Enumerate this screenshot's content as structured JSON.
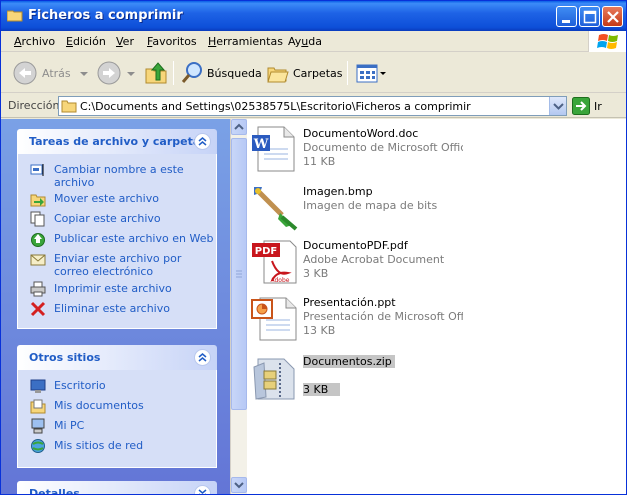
{
  "window": {
    "title": "Ficheros a comprimir"
  },
  "menu": [
    {
      "pre": "",
      "u": "A",
      "post": "rchivo"
    },
    {
      "pre": "",
      "u": "E",
      "post": "dición"
    },
    {
      "pre": "",
      "u": "V",
      "post": "er"
    },
    {
      "pre": "",
      "u": "F",
      "post": "avoritos"
    },
    {
      "pre": "",
      "u": "H",
      "post": "erramientas"
    },
    {
      "pre": "Ay",
      "u": "u",
      "post": "da"
    }
  ],
  "toolbar": {
    "back": "Atrás",
    "search": "Búsqueda",
    "folders": "Carpetas"
  },
  "address": {
    "label": "Dirección",
    "path": "C:\\Documents and Settings\\02538575L\\Escritorio\\Ficheros a comprimir",
    "go": "Ir"
  },
  "tasks_panel": {
    "title": "Tareas de archivo y carpeta",
    "items": [
      {
        "label": "Cambiar nombre a este archivo",
        "icon": "rename-icon"
      },
      {
        "label": "Mover este archivo",
        "icon": "move-icon"
      },
      {
        "label": "Copiar este archivo",
        "icon": "copy-icon"
      },
      {
        "label": "Publicar este archivo en Web",
        "icon": "publish-web-icon"
      },
      {
        "label": "Enviar este archivo por correo electrónico",
        "icon": "email-icon"
      },
      {
        "label": "Imprimir este archivo",
        "icon": "print-icon"
      },
      {
        "label": "Eliminar este archivo",
        "icon": "delete-icon"
      }
    ]
  },
  "places_panel": {
    "title": "Otros sitios",
    "items": [
      {
        "label": "Escritorio",
        "icon": "desktop-icon"
      },
      {
        "label": "Mis documentos",
        "icon": "my-documents-icon"
      },
      {
        "label": "Mi PC",
        "icon": "my-computer-icon"
      },
      {
        "label": "Mis sitios de red",
        "icon": "network-icon"
      }
    ]
  },
  "details_panel": {
    "title": "Detalles"
  },
  "files": [
    {
      "name": "DocumentoWord.doc",
      "type": "Documento de Microsoft Offic...",
      "size": "11 KB",
      "icon": "word-document-icon"
    },
    {
      "name": "Imagen.bmp",
      "type": "Imagen de mapa de bits",
      "size": "",
      "icon": "bitmap-image-icon"
    },
    {
      "name": "DocumentoPDF.pdf",
      "type": "Adobe Acrobat Document",
      "size": "3 KB",
      "icon": "pdf-document-icon"
    },
    {
      "name": "Presentación.ppt",
      "type": "Presentación de Microsoft Offi...",
      "size": "13 KB",
      "icon": "powerpoint-document-icon"
    },
    {
      "name": "Documentos.zip",
      "type": "",
      "size": "3 KB",
      "icon": "zip-archive-icon"
    }
  ],
  "colors": {
    "link": "#215dc6",
    "titlebar": "#0d4fd8",
    "selection": "#c5c5c5"
  }
}
